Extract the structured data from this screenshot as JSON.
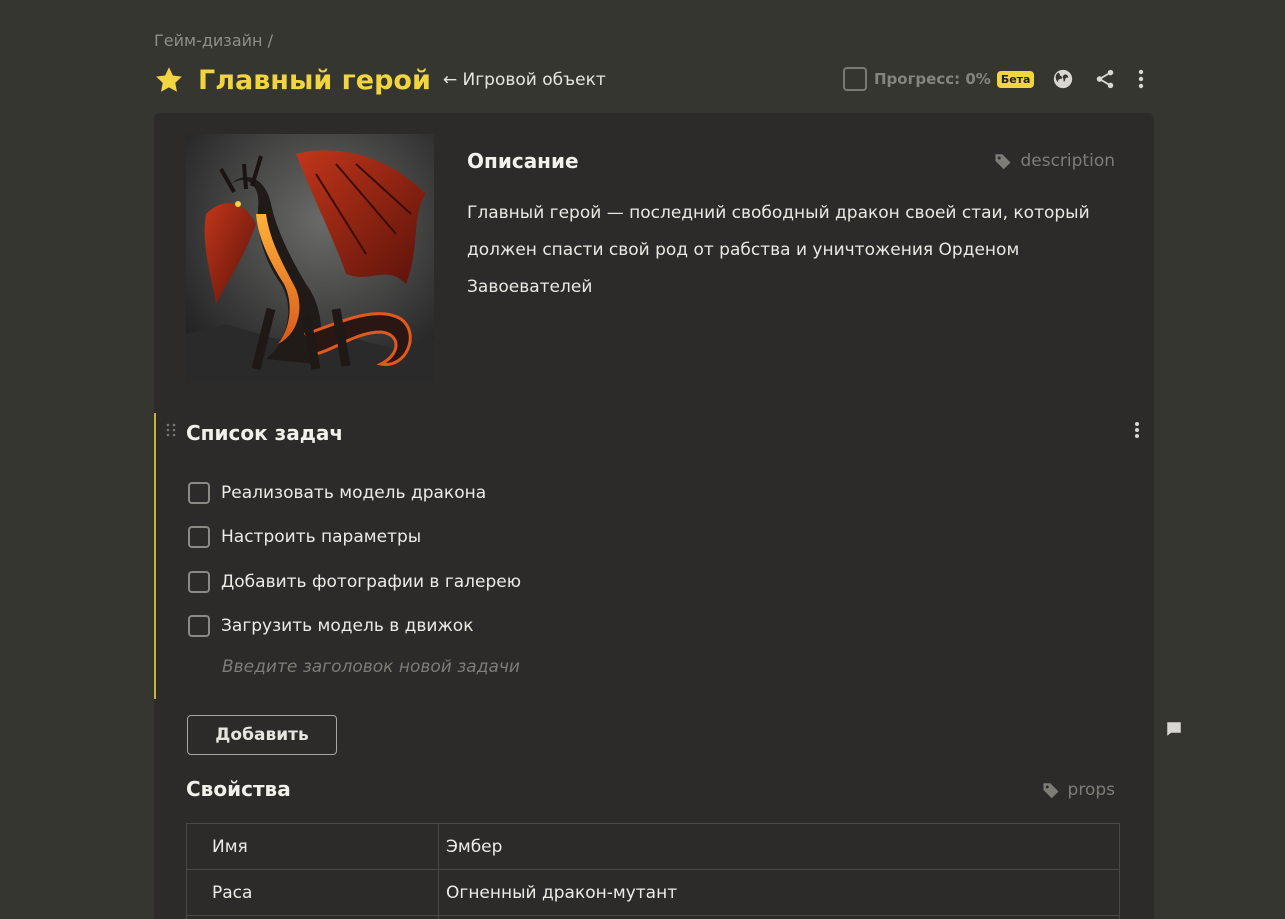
{
  "breadcrumb": "Гейм-дизайн /",
  "header": {
    "title": "Главный герой",
    "type_link": "← Игровой объект",
    "progress_label": "Прогресс: 0%",
    "beta_badge": "Бета"
  },
  "description": {
    "title": "Описание",
    "tag": "description",
    "text": "Главный герой — последний свободный дракон своей стаи, который должен спасти свой род от рабства и уничтожения Орденом Завоевателей"
  },
  "tasks": {
    "title": "Список задач",
    "items": [
      {
        "label": "Реализовать модель дракона",
        "checked": false
      },
      {
        "label": "Настроить параметры",
        "checked": false
      },
      {
        "label": "Добавить фотографии в галерею",
        "checked": false
      },
      {
        "label": "Загрузить модель в движок",
        "checked": false
      }
    ],
    "new_task_placeholder": "Введите заголовок новой задачи",
    "add_button": "Добавить"
  },
  "properties": {
    "title": "Свойства",
    "tag": "props",
    "rows": [
      {
        "key": "Имя",
        "value": "Эмбер"
      },
      {
        "key": "Раса",
        "value": "Огненный дракон-мутант"
      }
    ]
  },
  "icons": {
    "favorite": "star-icon",
    "globe": "globe-icon",
    "share": "share-icon",
    "more": "more-vertical-icon",
    "tag": "tag-icon",
    "drag": "drag-handle-icon",
    "comment": "comment-icon"
  },
  "colors": {
    "accent": "#f0d541",
    "background": "#363631",
    "card": "#2c2b29"
  }
}
